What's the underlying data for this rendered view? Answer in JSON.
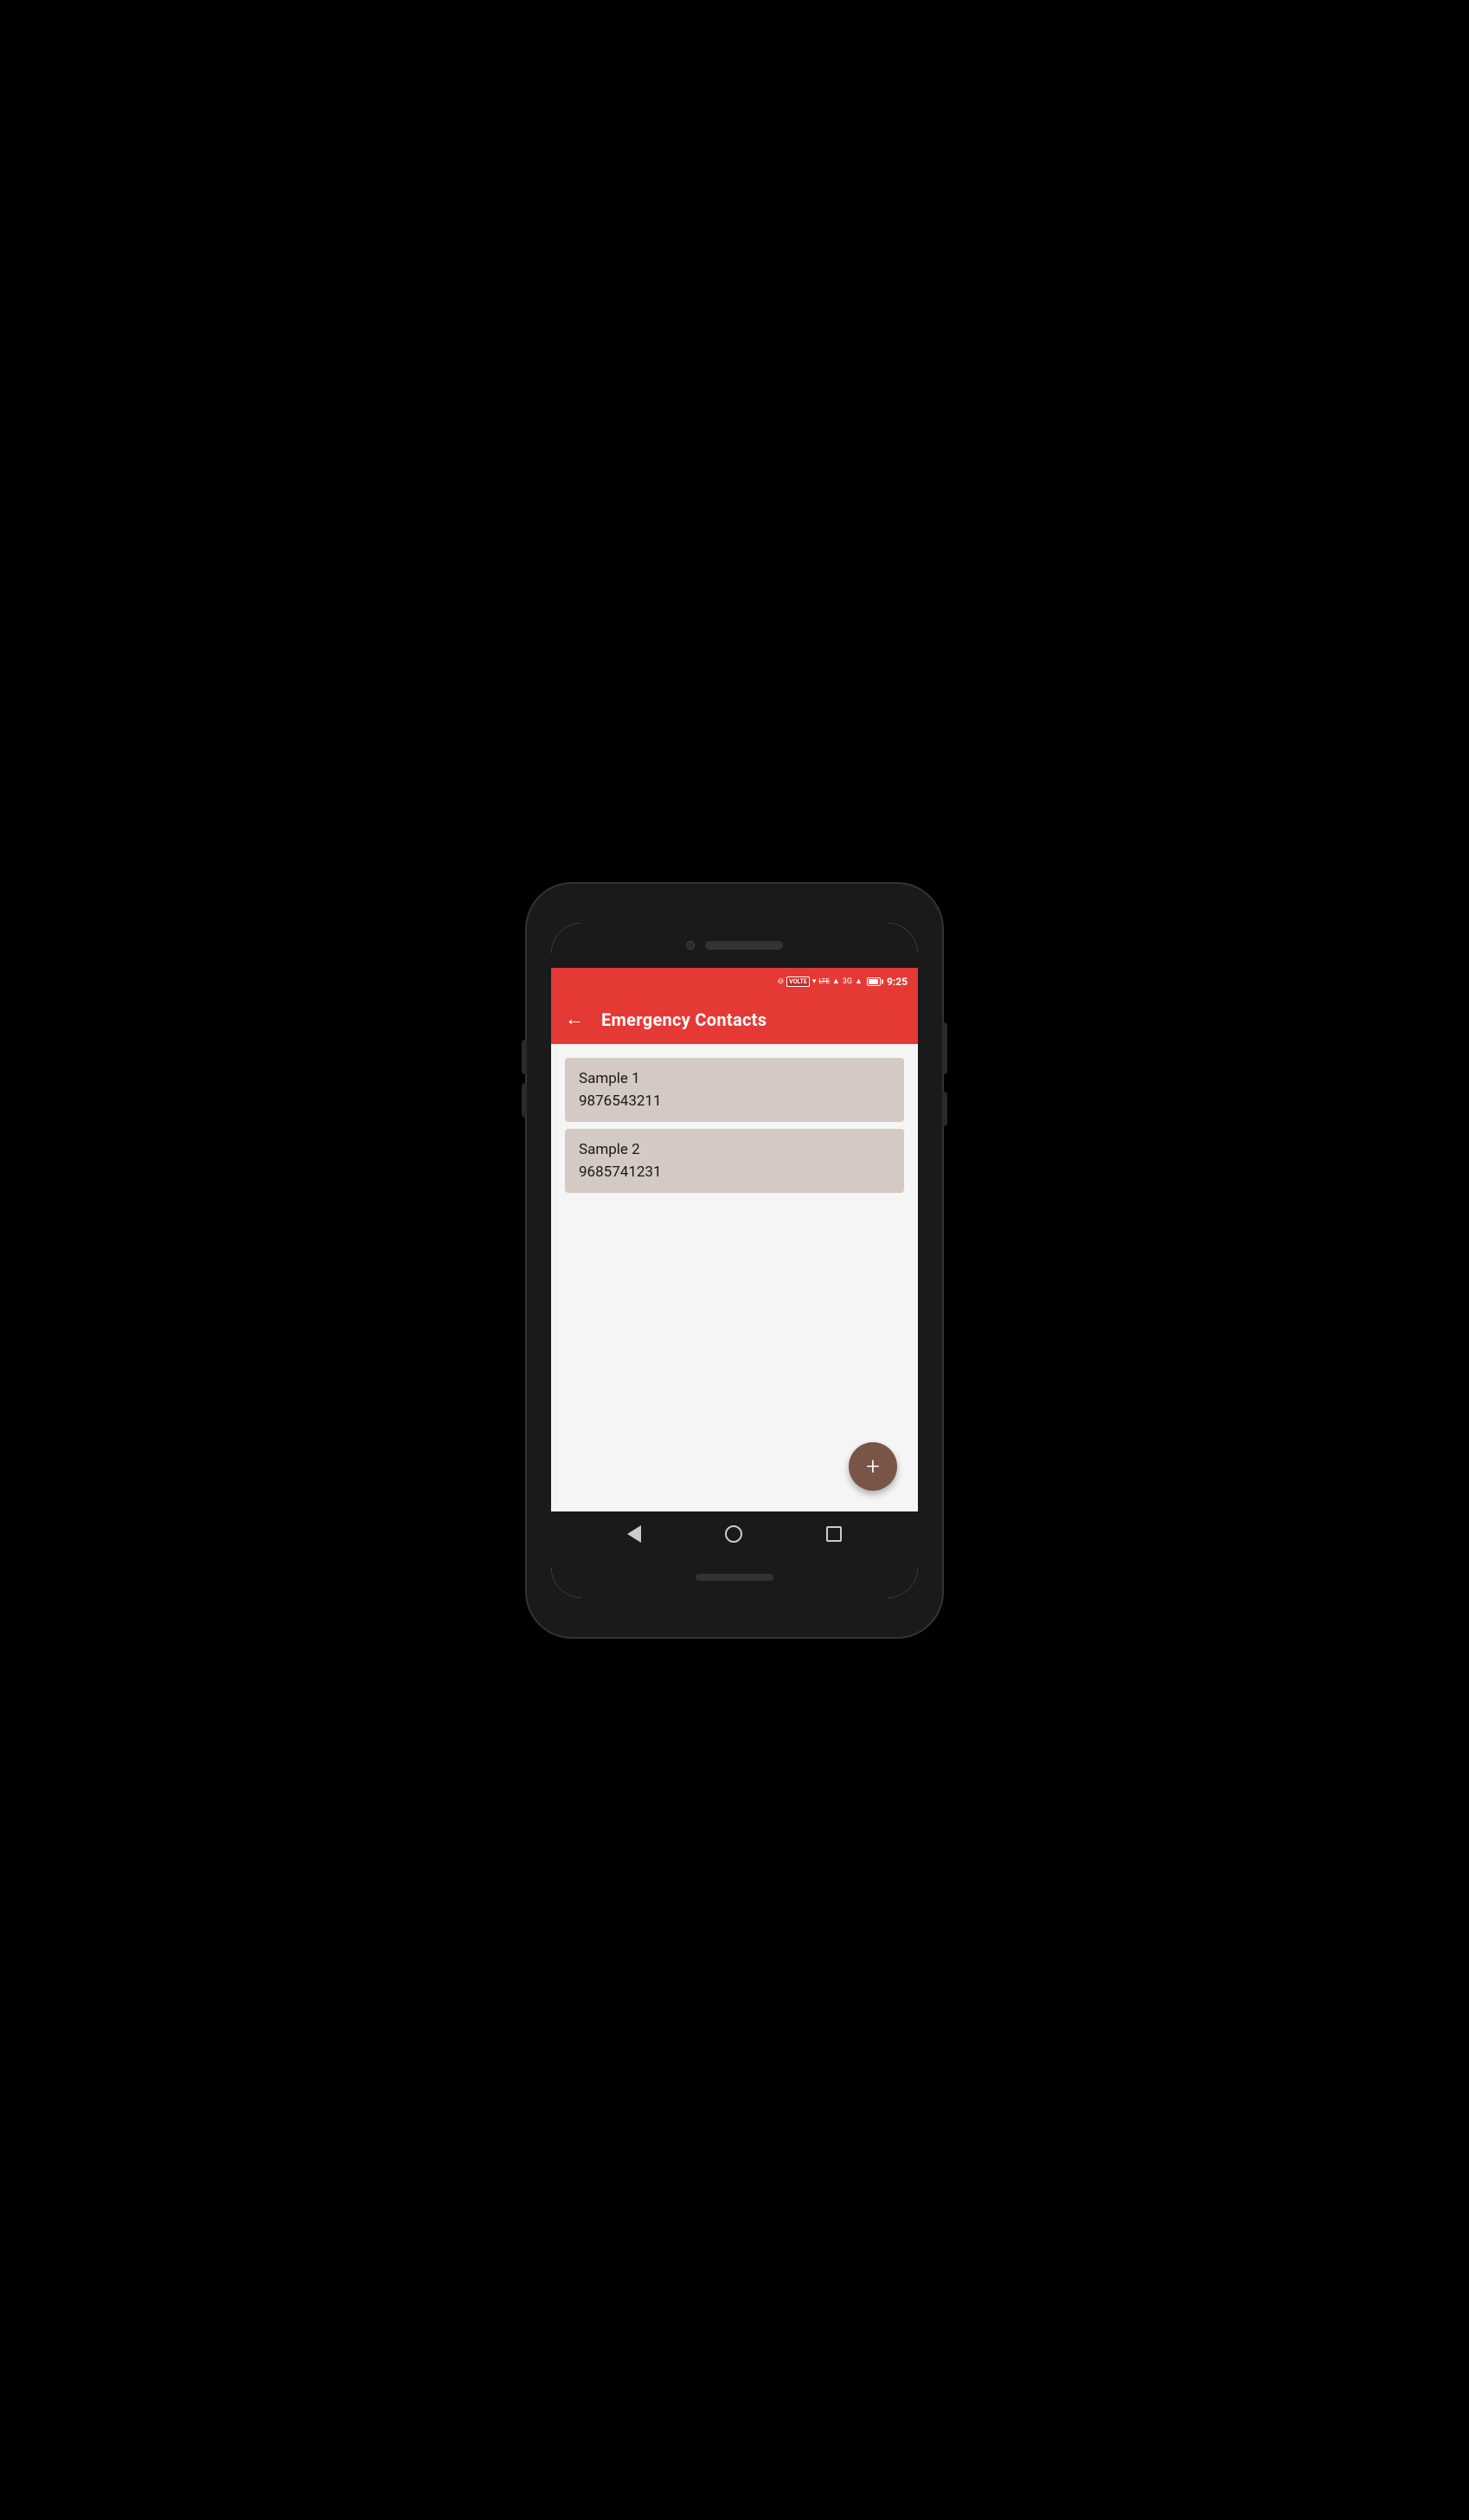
{
  "status_bar": {
    "time": "9:25",
    "volte": "VOLTE",
    "network": "3G"
  },
  "app_bar": {
    "title": "Emergency Contacts",
    "back_label": "←"
  },
  "contacts": [
    {
      "name": "Sample 1",
      "phone": "9876543211"
    },
    {
      "name": "Sample 2",
      "phone": "9685741231"
    }
  ],
  "fab": {
    "label": "+"
  },
  "nav": {
    "back": "",
    "home": "",
    "recents": ""
  }
}
